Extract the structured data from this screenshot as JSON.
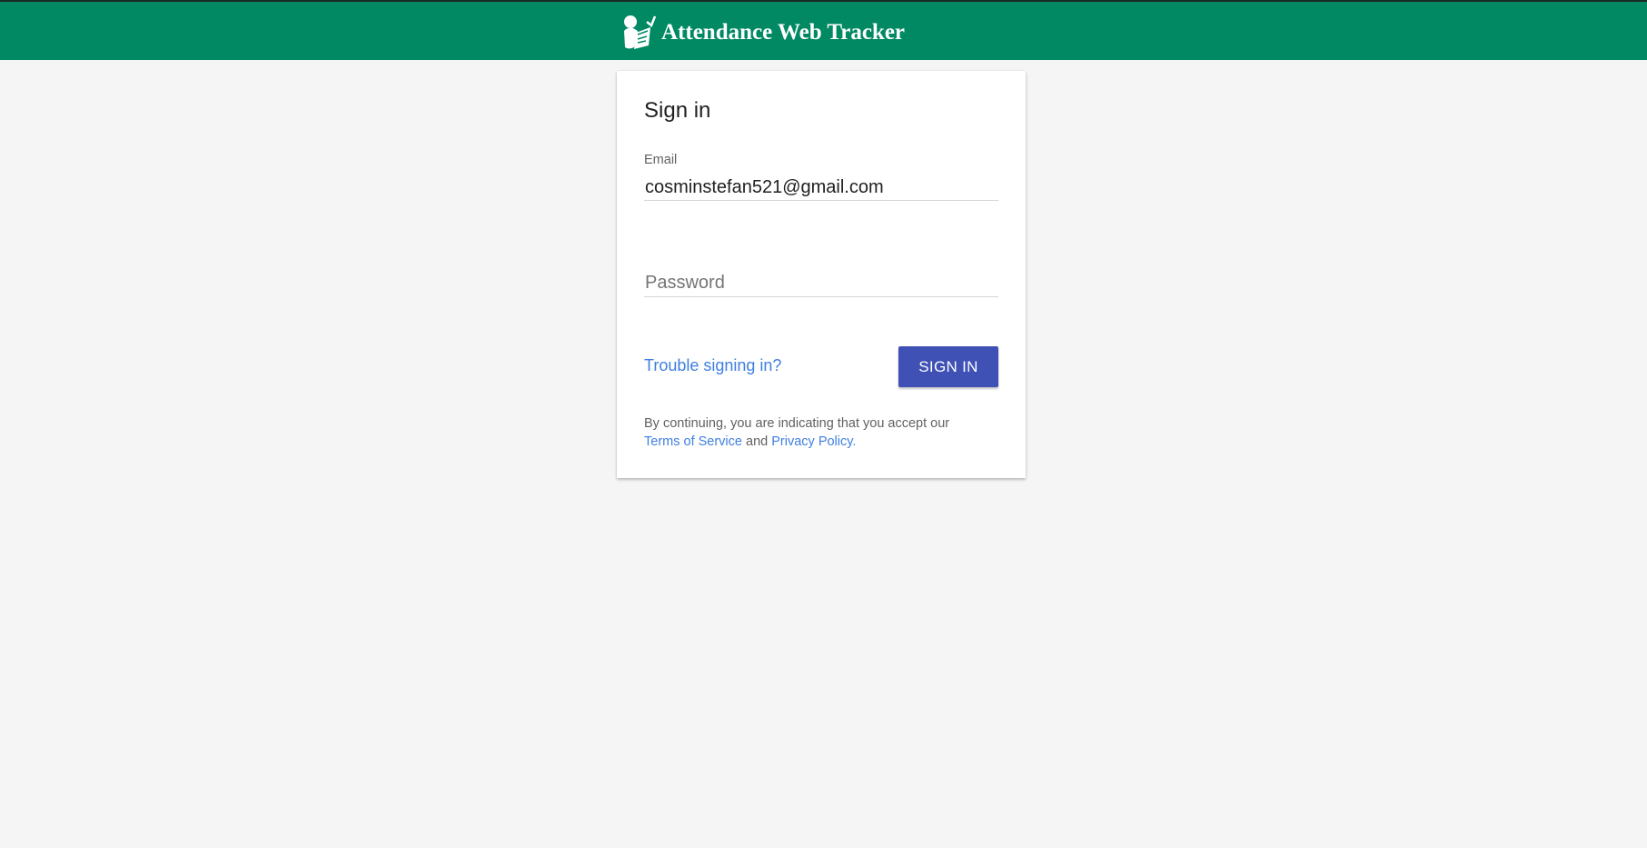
{
  "header": {
    "logo_icon": "attendance-person-checklist-icon",
    "title": "Attendance Web Tracker",
    "bar_color": "#008963"
  },
  "signin_card": {
    "title": "Sign in",
    "email": {
      "label": "Email",
      "value": "cosminstefan521@gmail.com"
    },
    "password": {
      "placeholder": "Password",
      "value": ""
    },
    "trouble_link": "Trouble signing in?",
    "submit_label": "SIGN IN",
    "submit_color": "#3f51b5",
    "legal": {
      "prefix": "By continuing, you are indicating that you accept our",
      "terms_link": "Terms of Service",
      "conjunction": "and",
      "privacy_link": "Privacy Policy",
      "suffix": "."
    }
  }
}
